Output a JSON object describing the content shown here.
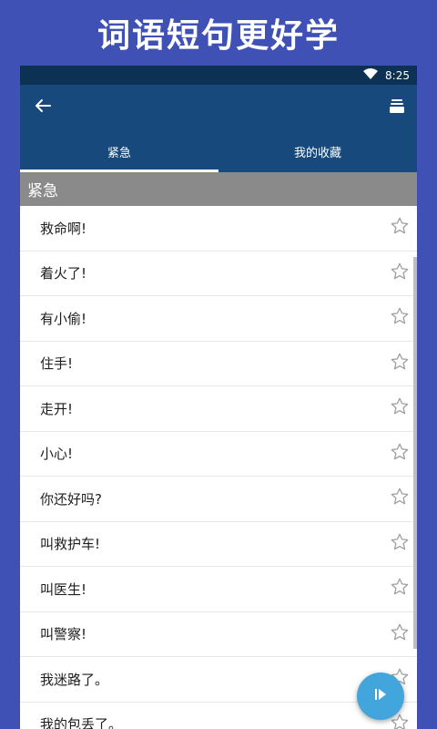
{
  "promo": {
    "title": "词语短句更好学"
  },
  "statusbar": {
    "time": "8:25"
  },
  "tabs": [
    {
      "label": "紧急",
      "active": true
    },
    {
      "label": "我的收藏",
      "active": false
    }
  ],
  "section": {
    "title": "紧急"
  },
  "phrases": [
    "救命啊!",
    "着火了!",
    "有小偷!",
    "住手!",
    "走开!",
    "小心!",
    "你还好吗?",
    "叫救护车!",
    "叫医生!",
    "叫警察!",
    "我迷路了。",
    "我的包丢了。"
  ],
  "icons": {
    "back": "arrow-left-icon",
    "menu": "stack-icon",
    "favorite": "star-outline-icon",
    "play": "play-icon",
    "wifi": "wifi-icon"
  },
  "colors": {
    "background": "#3f51b5",
    "appbar": "#17497c",
    "statusbar": "#0d3154",
    "section_header": "#8a8a8a",
    "fab": "#42a5dc"
  }
}
